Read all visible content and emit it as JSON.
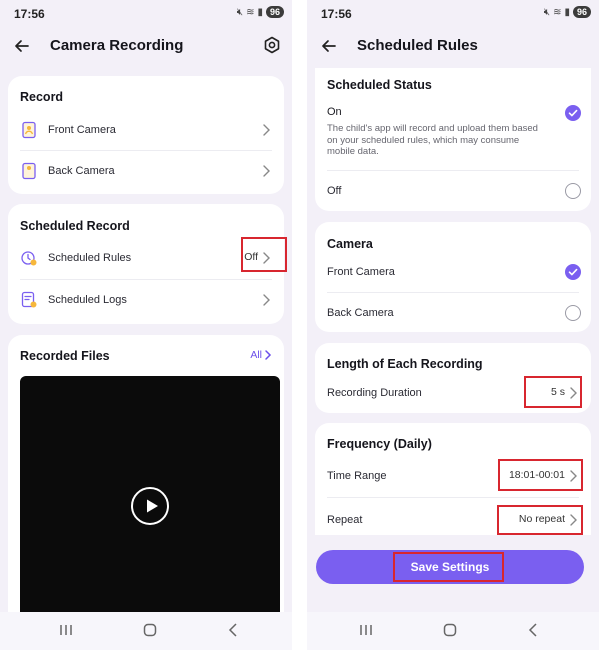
{
  "left": {
    "status": {
      "time": "17:56",
      "battery": "96"
    },
    "title": "Camera Recording",
    "record": {
      "title": "Record",
      "items": [
        {
          "label": "Front Camera"
        },
        {
          "label": "Back Camera"
        }
      ]
    },
    "scheduled": {
      "title": "Scheduled Record",
      "rules_label": "Scheduled Rules",
      "rules_value": "Off",
      "logs_label": "Scheduled Logs"
    },
    "files": {
      "title": "Recorded Files",
      "all_label": "All"
    }
  },
  "right": {
    "status": {
      "time": "17:56",
      "battery": "96"
    },
    "title": "Scheduled Rules",
    "status_card": {
      "title": "Scheduled Status",
      "on_label": "On",
      "on_desc": "The child's app will record and upload them based on your scheduled rules, which may consume mobile data.",
      "off_label": "Off",
      "selected": "On"
    },
    "camera": {
      "title": "Camera",
      "front_label": "Front Camera",
      "back_label": "Back Camera",
      "selected": "Front Camera"
    },
    "length": {
      "title": "Length of Each Recording",
      "duration_label": "Recording Duration",
      "duration_value": "5 s"
    },
    "frequency": {
      "title": "Frequency (Daily)",
      "time_range_label": "Time Range",
      "time_range_value": "18:01-00:01",
      "repeat_label": "Repeat",
      "repeat_value": "No repeat"
    },
    "save_label": "Save Settings"
  },
  "colors": {
    "accent": "#7a5ff0",
    "highlight": "#d8262f",
    "background": "#f3f0f8"
  }
}
